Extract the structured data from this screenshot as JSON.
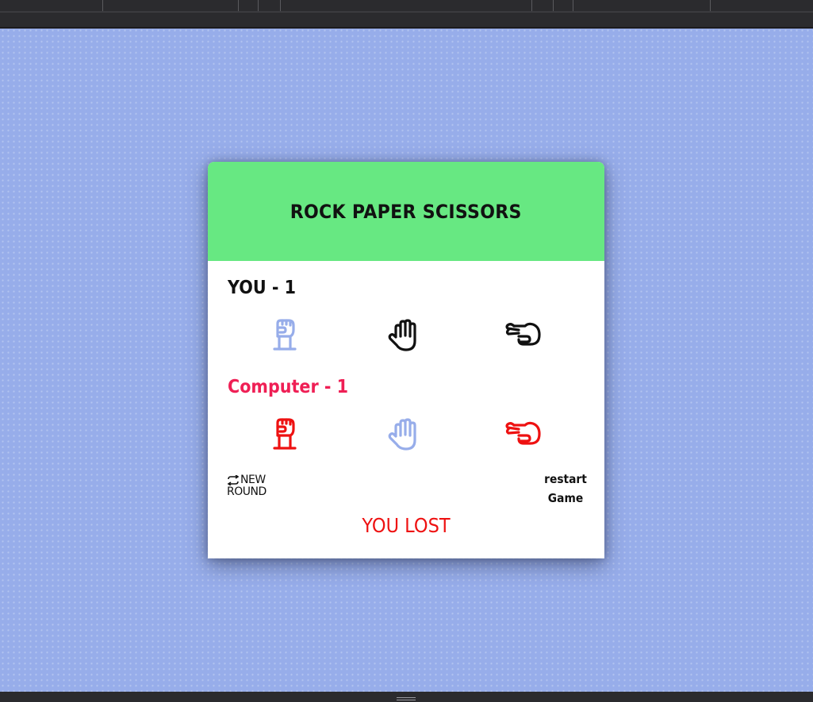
{
  "header": {
    "title": "ROCK PAPER SCISSORS"
  },
  "player": {
    "label": "YOU - ",
    "score": "1",
    "choices": [
      {
        "name": "rock",
        "icon": "rock-hand-icon",
        "state": "selected",
        "color": "#97adea"
      },
      {
        "name": "paper",
        "icon": "paper-hand-icon",
        "state": "idle",
        "color": "#111111"
      },
      {
        "name": "scissors",
        "icon": "scissors-hand-icon",
        "state": "idle",
        "color": "#111111"
      }
    ]
  },
  "computer": {
    "label": "Computer - ",
    "score": "1",
    "label_color": "#ef1f55",
    "choices": [
      {
        "name": "rock",
        "icon": "rock-hand-icon",
        "state": "idle",
        "color": "#ee1111"
      },
      {
        "name": "paper",
        "icon": "paper-hand-icon",
        "state": "selected",
        "color": "#97adea"
      },
      {
        "name": "scissors",
        "icon": "scissors-hand-icon",
        "state": "idle",
        "color": "#ee1111"
      }
    ]
  },
  "controls": {
    "new_round_line1": "NEW",
    "new_round_line2": "ROUND",
    "restart_line1": "restart",
    "restart_line2": "Game"
  },
  "result": {
    "text": "YOU LOST",
    "color": "#ee1111"
  },
  "theme": {
    "background": "#97adea",
    "header": "#67e882",
    "card": "#ffffff"
  }
}
